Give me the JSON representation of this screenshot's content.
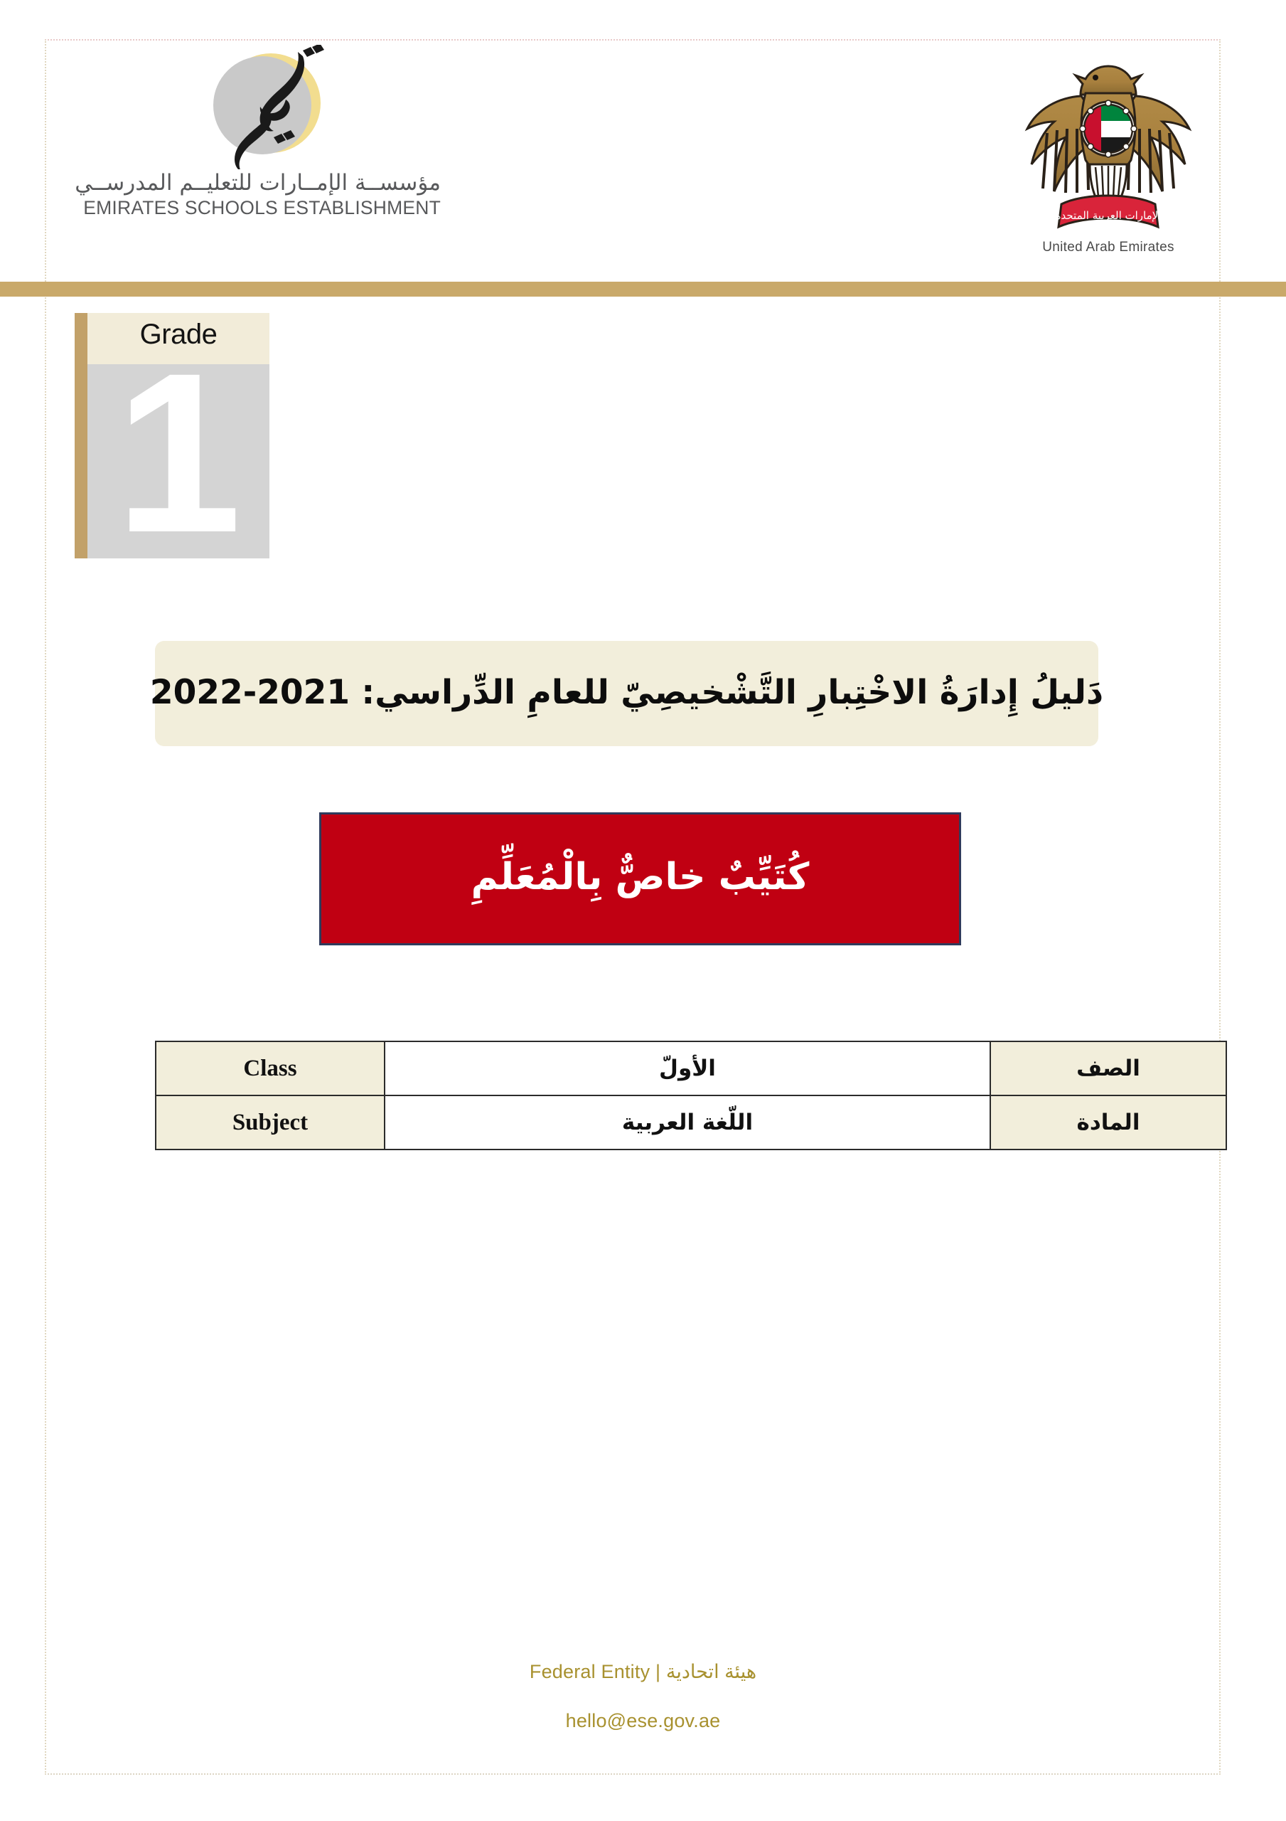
{
  "document": {
    "type": "cover-page",
    "language": "ar"
  },
  "header": {
    "ese_logo": {
      "mark_text": "تعليم",
      "arabic_name": "مؤسســة الإمــارات للتعليــم المدرســي",
      "english_name": "EMIRATES SCHOOLS ESTABLISHMENT"
    },
    "uae_emblem": {
      "scroll_text": "الإمارات العربية المتحدة",
      "caption": "United Arab Emirates"
    }
  },
  "grade_badge": {
    "label": "Grade",
    "number": "1"
  },
  "title_banner": {
    "text": "دَليلُ إِدارَةُ الاخْتِبارِ التَّشْخيصِيّ للعامِ الدِّراسي: 2021-2022"
  },
  "red_banner": {
    "text": "كُتَيِّبٌ خاصٌّ بِالْمُعَلِّمِ"
  },
  "info_table": {
    "rows": [
      {
        "english_label": "Class",
        "value": "الأولّ",
        "arabic_label": "الصف"
      },
      {
        "english_label": "Subject",
        "value": "اللّغة العربية",
        "arabic_label": "المادة"
      }
    ]
  },
  "footer": {
    "entity": "Federal Entity | هيئة اتحادية",
    "email": "hello@ese.gov.ae"
  },
  "colors": {
    "gold_bar": "#c9a96a",
    "cream": "#f2eedb",
    "red_banner": "#c00012",
    "red_banner_border": "#2f3b5c",
    "grade_spine": "#c2a169",
    "grade_body": "#d4d4d4",
    "footer_gold": "#a8912f"
  }
}
